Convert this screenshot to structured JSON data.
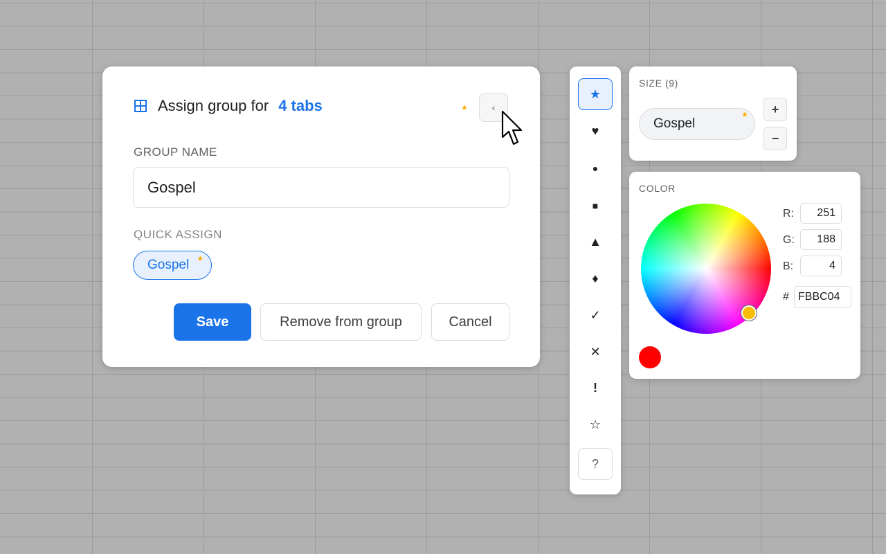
{
  "dialog": {
    "title_prefix": "Assign group for",
    "title_count": "4 tabs",
    "collapse_icon": "chevron-left-icon",
    "collapse_glyph": "‹",
    "group_name_label": "GROUP NAME",
    "group_name_value": "Gospel",
    "quick_assign_label": "QUICK ASSIGN",
    "quick_assign_chip": "Gospel",
    "buttons": {
      "save": "Save",
      "remove": "Remove from group",
      "cancel": "Cancel"
    }
  },
  "palette": {
    "items": [
      {
        "icon": "star-filled-icon",
        "glyph": "★",
        "selected": true
      },
      {
        "icon": "heart-icon",
        "glyph": "♥",
        "selected": false
      },
      {
        "icon": "circle-icon",
        "glyph": "●",
        "selected": false
      },
      {
        "icon": "square-icon",
        "glyph": "■",
        "selected": false
      },
      {
        "icon": "triangle-icon",
        "glyph": "▲",
        "selected": false
      },
      {
        "icon": "diamond-icon",
        "glyph": "♦",
        "selected": false
      },
      {
        "icon": "checkmark-icon",
        "glyph": "✓",
        "selected": false
      },
      {
        "icon": "cross-icon",
        "glyph": "✕",
        "selected": false
      },
      {
        "icon": "exclamation-icon",
        "glyph": "!",
        "selected": false
      },
      {
        "icon": "star-outline-icon",
        "glyph": "☆",
        "selected": false
      },
      {
        "icon": "question-icon",
        "glyph": "?",
        "selected": false
      }
    ]
  },
  "size": {
    "label": "SIZE (9)",
    "preview_chip": "Gospel",
    "increase": "+",
    "decrease": "−"
  },
  "color": {
    "label": "COLOR",
    "r_label": "R:",
    "r": "251",
    "g_label": "G:",
    "g": "188",
    "b_label": "B:",
    "b": "4",
    "hex_label": "#",
    "hex": "FBBC04",
    "selected_color": "#fbbc04",
    "swatch_color": "#ff0000"
  },
  "colors": {
    "accent": "#1a73e8",
    "star": "#f9ab00"
  }
}
